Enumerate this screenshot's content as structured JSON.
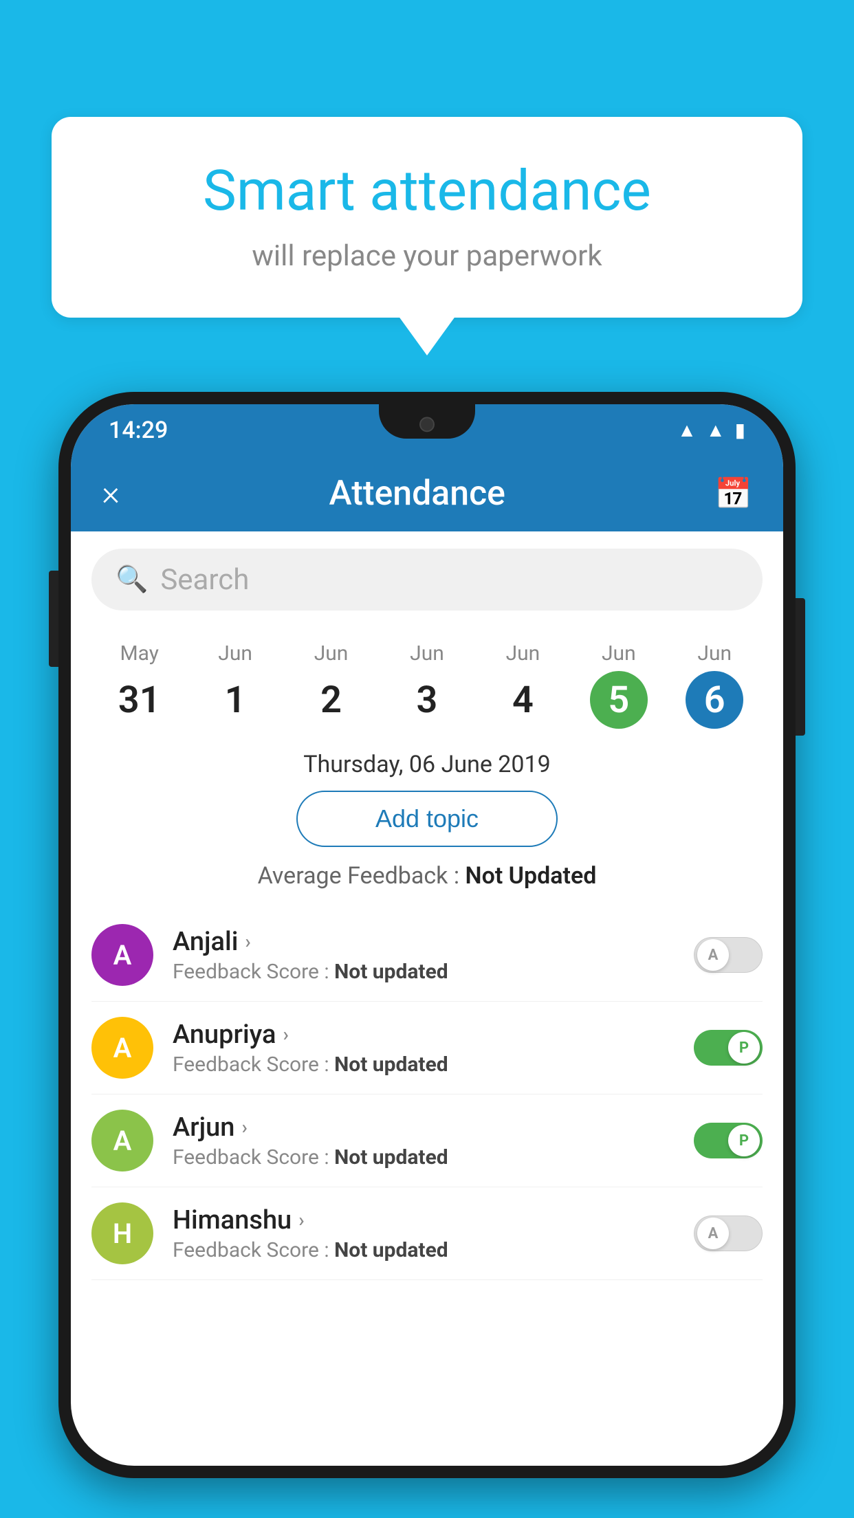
{
  "background_color": "#1ab8e8",
  "bubble": {
    "title": "Smart attendance",
    "subtitle": "will replace your paperwork"
  },
  "phone": {
    "status_bar": {
      "time": "14:29",
      "icons": [
        "wifi",
        "signal",
        "battery"
      ]
    },
    "app_bar": {
      "close_label": "×",
      "title": "Attendance",
      "calendar_icon": "📅"
    },
    "search": {
      "placeholder": "Search"
    },
    "calendar": {
      "days": [
        {
          "month": "May",
          "date": "31",
          "style": "normal"
        },
        {
          "month": "Jun",
          "date": "1",
          "style": "normal"
        },
        {
          "month": "Jun",
          "date": "2",
          "style": "normal"
        },
        {
          "month": "Jun",
          "date": "3",
          "style": "normal"
        },
        {
          "month": "Jun",
          "date": "4",
          "style": "normal"
        },
        {
          "month": "Jun",
          "date": "5",
          "style": "today"
        },
        {
          "month": "Jun",
          "date": "6",
          "style": "selected"
        }
      ]
    },
    "selected_date": "Thursday, 06 June 2019",
    "add_topic_label": "Add topic",
    "avg_feedback_label": "Average Feedback :",
    "avg_feedback_value": "Not Updated",
    "students": [
      {
        "name": "Anjali",
        "avatar_letter": "A",
        "avatar_color": "#9c27b0",
        "feedback_label": "Feedback Score :",
        "feedback_value": "Not updated",
        "toggle": "off",
        "toggle_letter": "A"
      },
      {
        "name": "Anupriya",
        "avatar_letter": "A",
        "avatar_color": "#ffc107",
        "feedback_label": "Feedback Score :",
        "feedback_value": "Not updated",
        "toggle": "on",
        "toggle_letter": "P"
      },
      {
        "name": "Arjun",
        "avatar_letter": "A",
        "avatar_color": "#8bc34a",
        "feedback_label": "Feedback Score :",
        "feedback_value": "Not updated",
        "toggle": "on",
        "toggle_letter": "P"
      },
      {
        "name": "Himanshu",
        "avatar_letter": "H",
        "avatar_color": "#a5c442",
        "feedback_label": "Feedback Score :",
        "feedback_value": "Not updated",
        "toggle": "off",
        "toggle_letter": "A"
      }
    ]
  }
}
